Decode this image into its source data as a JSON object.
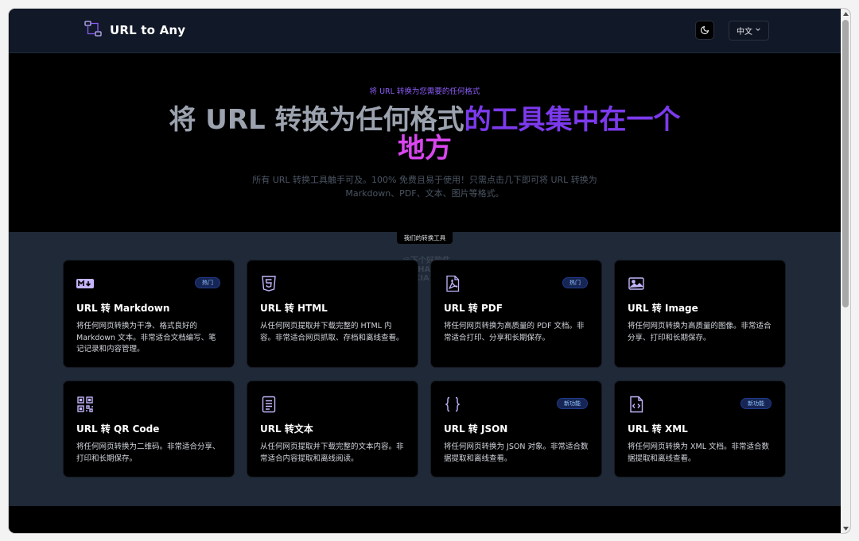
{
  "header": {
    "brand": "URL to Any",
    "language": "中文"
  },
  "hero": {
    "kicker": "将 URL 转换为您需要的任何格式",
    "title_part1": "将 URL 转换为任何格式",
    "title_part2": "的工具集中在一个",
    "title_part3": "地方",
    "description": "所有 URL 转换工具触手可及。100% 免费且易于使用！只需点击几下即可将 URL 转换为 Markdown、PDF、文本、图片等格式。"
  },
  "tools": {
    "section_label": "我们的转换工具",
    "watermark_line1": "@下个好软件",
    "watermark_line2": "XIAHAO.VC",
    "watermark_line3": "////XIA.VC",
    "cards": [
      {
        "title": "URL 转 Markdown",
        "desc": "将任何网页转换为干净、格式良好的 Markdown 文本。非常适合文档编写、笔记记录和内容管理。",
        "tag": "热门",
        "icon": "markdown-icon"
      },
      {
        "title": "URL 转 HTML",
        "desc": "从任何网页提取并下载完整的 HTML 内容。非常适合网页抓取、存档和离线查看。",
        "tag": "",
        "icon": "html5-icon"
      },
      {
        "title": "URL 转 PDF",
        "desc": "将任何网页转换为高质量的 PDF 文档。非常适合打印、分享和长期保存。",
        "tag": "热门",
        "icon": "pdf-icon"
      },
      {
        "title": "URL 转 Image",
        "desc": "将任何网页转换为高质量的图像。非常适合分享、打印和长期保存。",
        "tag": "",
        "icon": "image-icon"
      },
      {
        "title": "URL 转 QR Code",
        "desc": "将任何网页转换为二维码。非常适合分享、打印和长期保存。",
        "tag": "",
        "icon": "qr-code-icon"
      },
      {
        "title": "URL 转文本",
        "desc": "从任何网页提取并下载完整的文本内容。非常适合内容提取和离线阅读。",
        "tag": "",
        "icon": "text-document-icon"
      },
      {
        "title": "URL 转 JSON",
        "desc": "将任何网页转换为 JSON 对象。非常适合数据提取和离线查看。",
        "tag": "新功能",
        "icon": "json-braces-icon"
      },
      {
        "title": "URL 转 XML",
        "desc": "将任何网页转换为 XML 文档。非常适合数据提取和离线查看。",
        "tag": "新功能",
        "icon": "xml-file-icon"
      }
    ]
  }
}
